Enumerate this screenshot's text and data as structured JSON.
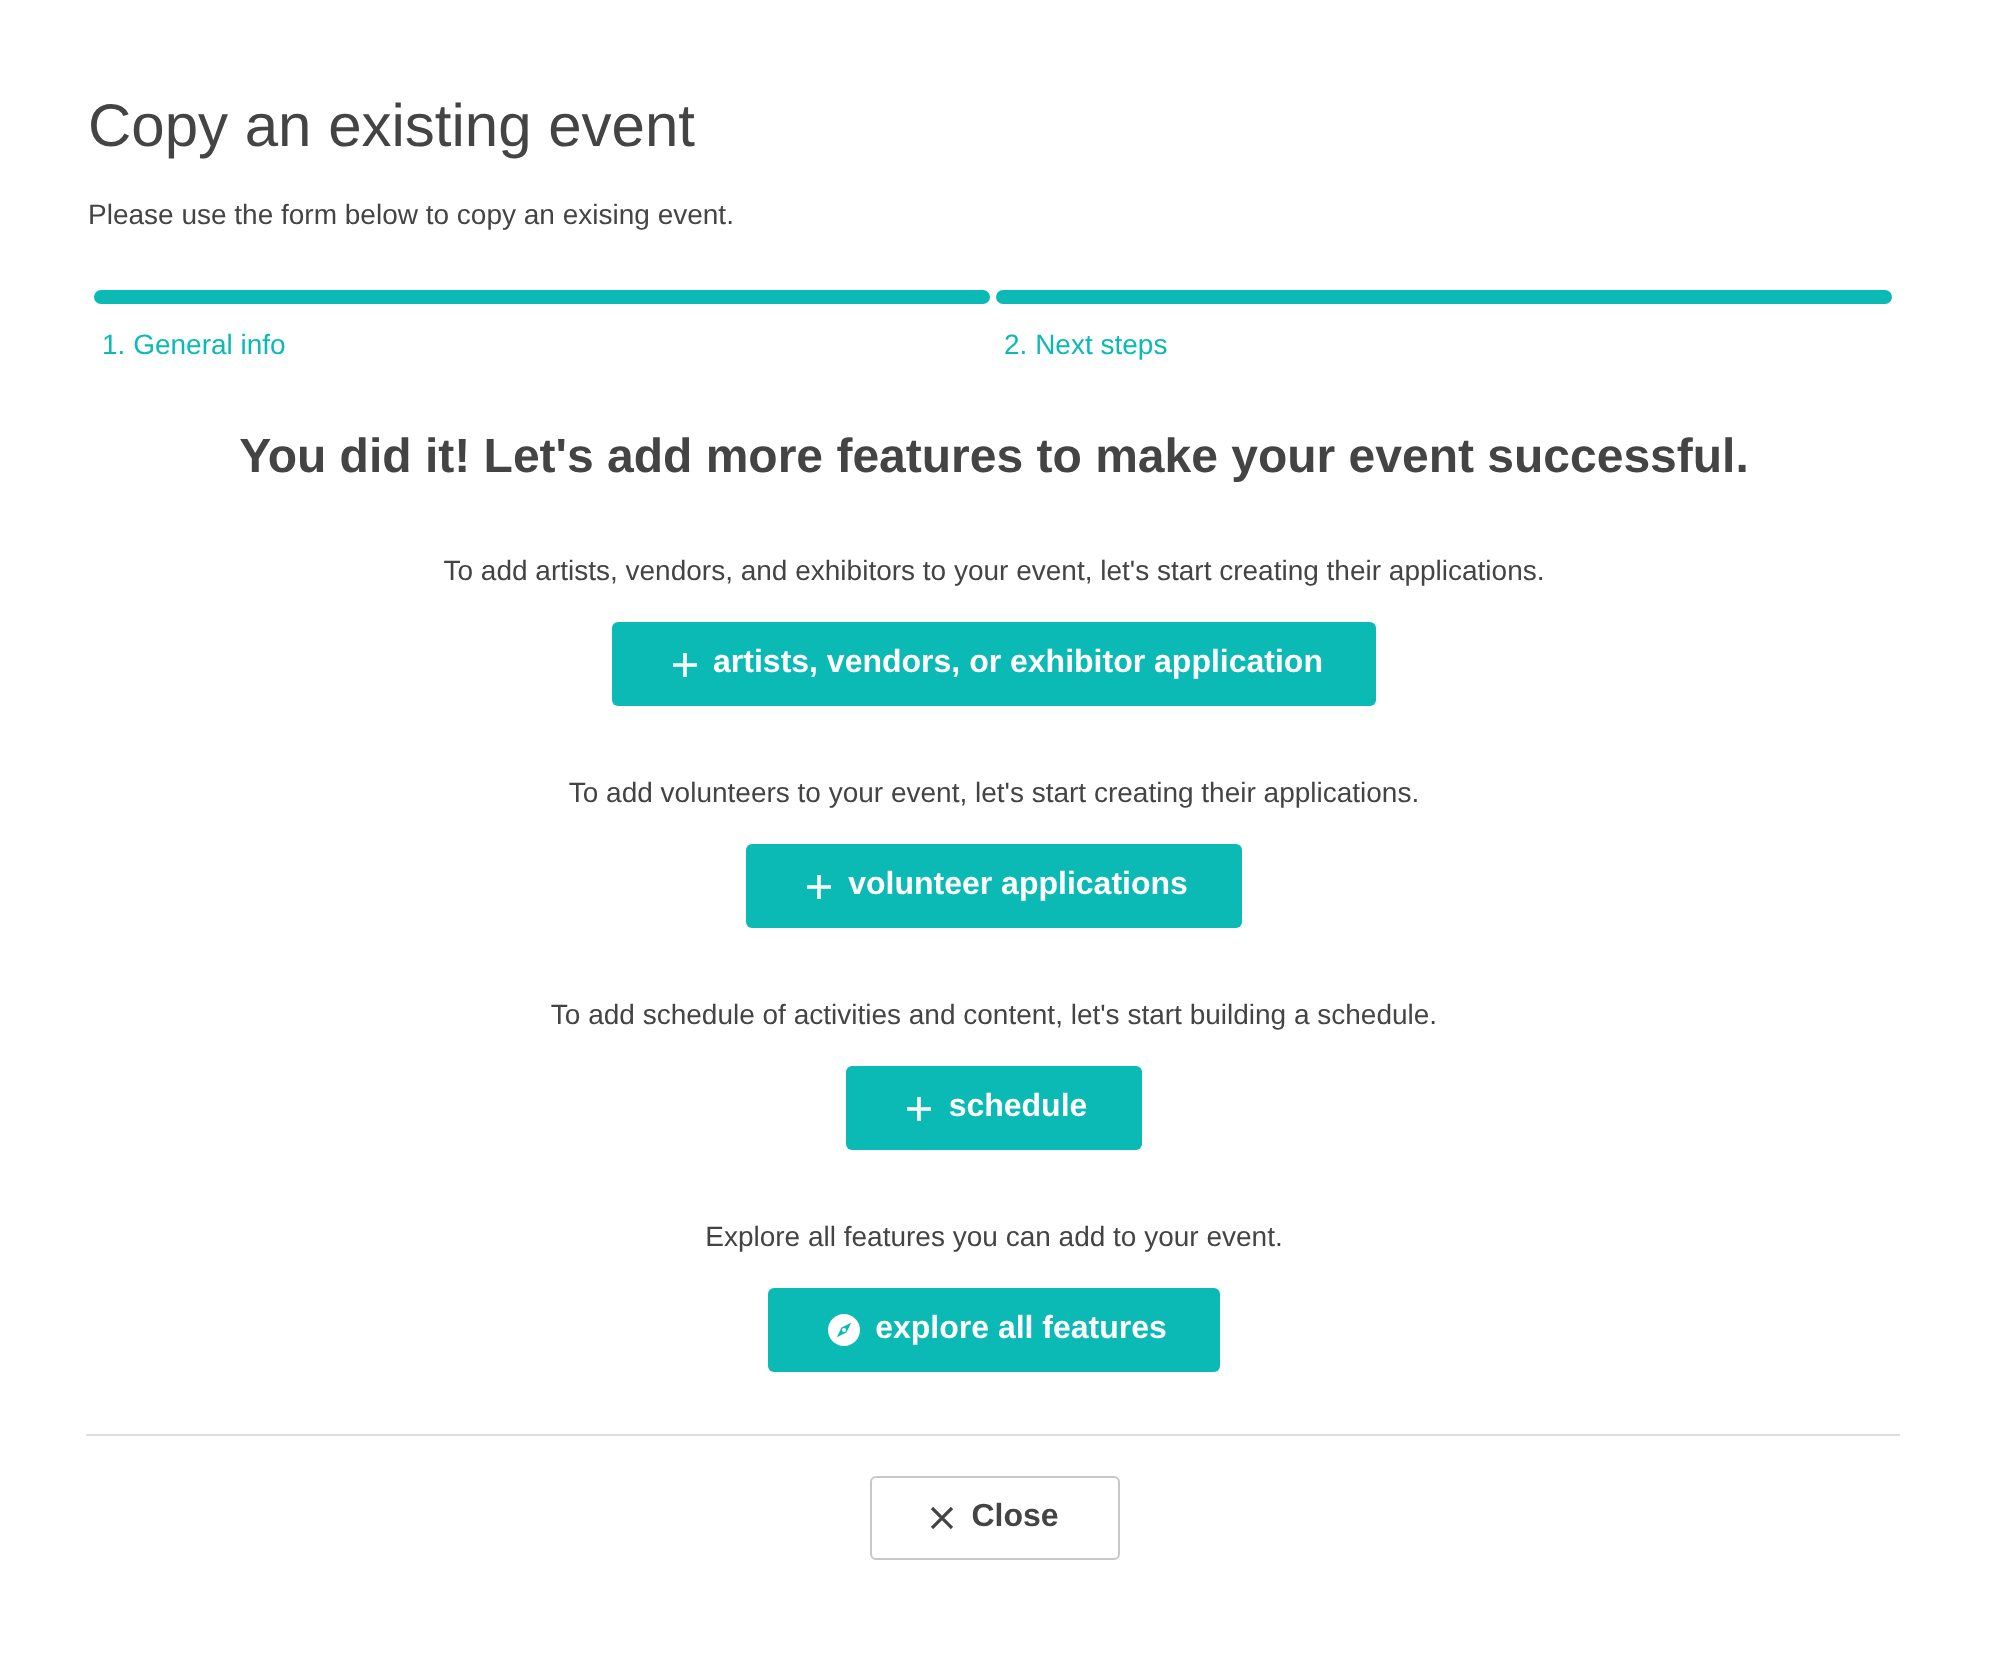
{
  "dialog": {
    "title": "Copy an existing event",
    "subtitle": "Please use the form below to copy an exising event."
  },
  "steps": [
    {
      "label": "1. General info",
      "done": true
    },
    {
      "label": "2. Next steps",
      "done": true
    }
  ],
  "heading": "You did it! Let's add more features to make your event successful.",
  "sections": [
    {
      "text": "To add artists, vendors, and exhibitors to your event, let's start creating their applications.",
      "button": {
        "label": "artists, vendors, or exhibitor application",
        "kind": "add"
      }
    },
    {
      "text": "To add volunteers to your event, let's start creating their applications.",
      "button": {
        "label": "volunteer applications",
        "kind": "add"
      }
    },
    {
      "text": "To add schedule of activities and content, let's start building a schedule.",
      "button": {
        "label": "schedule",
        "kind": "add"
      }
    },
    {
      "text": "Explore all features you can add to your event.",
      "button": {
        "label": "explore all features",
        "kind": "explore"
      }
    }
  ],
  "footer": {
    "close_button": {
      "label": "Close"
    }
  }
}
